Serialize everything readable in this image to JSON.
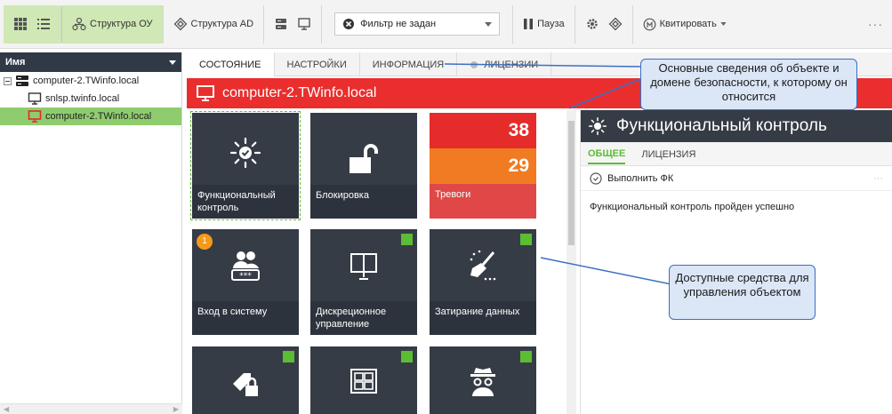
{
  "toolbar": {
    "structure_ou": "Структура ОУ",
    "structure_ad": "Структура AD",
    "filter": "Фильтр не задан",
    "pause": "Пауза",
    "acknowledge": "Квитировать"
  },
  "tree": {
    "header": "Имя",
    "items": [
      {
        "label": "computer-2.TWinfo.local"
      },
      {
        "label": "snlsp.twinfo.local"
      },
      {
        "label": "computer-2.TWinfo.local"
      }
    ]
  },
  "tabs": [
    {
      "label": "СОСТОЯНИЕ"
    },
    {
      "label": "НАСТРОЙКИ"
    },
    {
      "label": "ИНФОРМАЦИЯ"
    },
    {
      "label": "ЛИЦЕНЗИИ"
    }
  ],
  "object_title": "computer-2.TWinfo.local",
  "tiles": [
    {
      "label": "Функциональный контроль"
    },
    {
      "label": "Блокировка"
    },
    {
      "label": "Тревоги",
      "count_top": "38",
      "count_bottom": "29"
    },
    {
      "label": "Вход в систему",
      "badge": "1"
    },
    {
      "label": "Дискреционное управление"
    },
    {
      "label": "Затирание данных"
    }
  ],
  "panel": {
    "title": "Функциональный контроль",
    "tab_general": "ОБЩЕЕ",
    "tab_license": "ЛИЦЕНЗИЯ",
    "action": "Выполнить ФК",
    "message": "Функциональный контроль пройден успешно"
  },
  "callouts": {
    "top": "Основные сведения об объекте и домене безопасности, к которому он относится",
    "bottom": "Доступные средства для управления объектом"
  },
  "colors": {
    "accent_green": "#5cbc34",
    "alarm_red": "#ea2e2e",
    "warn_orange": "#f07b22",
    "tile_dark": "#363c46"
  }
}
